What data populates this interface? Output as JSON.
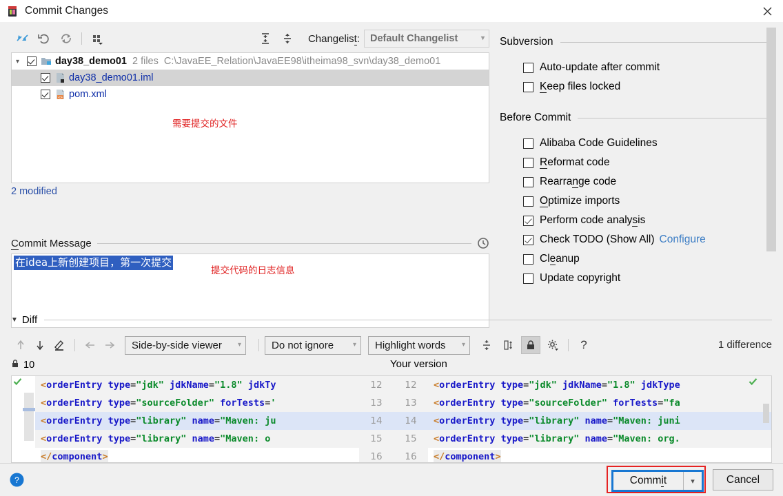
{
  "window": {
    "title": "Commit Changes",
    "app_icon": "intellij-idea-icon",
    "close_label": "✕"
  },
  "toolbar": {
    "buttons": [
      {
        "name": "show-diff-icon",
        "tooltip": "Show Diff"
      },
      {
        "name": "revert-icon",
        "tooltip": "Revert"
      },
      {
        "name": "refresh-icon",
        "tooltip": "Refresh"
      },
      {
        "name": "group-by-icon",
        "tooltip": "Group By"
      },
      {
        "name": "expand-all-icon",
        "tooltip": "Expand All"
      },
      {
        "name": "collapse-all-icon",
        "tooltip": "Collapse All"
      }
    ],
    "changelist_label": "Changelist:",
    "changelist_label_mnemonic": "Changelis",
    "changelist_label_underlined": "t",
    "changelist_label_tail": ":",
    "changelist_value": "Default Changelist"
  },
  "file_tree": {
    "root": {
      "name": "day38_demo01",
      "files_count": "2 files",
      "path": "C:\\JavaEE_Relation\\JavaEE98\\itheima98_svn\\day38_demo01",
      "checked": true,
      "expanded": true
    },
    "children": [
      {
        "name": "day38_demo01.iml",
        "checked": true,
        "selected": true,
        "icon": "iml-file-icon"
      },
      {
        "name": "pom.xml",
        "checked": true,
        "selected": false,
        "icon": "xml-file-icon"
      }
    ],
    "annotation": "需要提交的文件",
    "status": "2 modified"
  },
  "commit_message": {
    "label": "Commit Message",
    "label_mnemonic": "C",
    "label_rest": "ommit Message",
    "value": "在idea上新创建项目，第一次提交",
    "history_icon": "clock-icon",
    "annotation": "提交代码的日志信息"
  },
  "right_panel": {
    "groups": [
      {
        "title": "Subversion",
        "options": [
          {
            "label": "Auto-update after commit",
            "checked": false,
            "mnemonic": ""
          },
          {
            "label": "Keep files locked",
            "checked": false,
            "mnemonic": "K",
            "label_rest": "eep files locked"
          }
        ]
      },
      {
        "title": "Before Commit",
        "options": [
          {
            "label": "Alibaba Code Guidelines",
            "checked": false,
            "mnemonic": ""
          },
          {
            "label": "Reformat code",
            "checked": false,
            "mnemonic": "R",
            "label_rest": "eformat code"
          },
          {
            "label": "Rearrange code",
            "checked": false,
            "mnemonic": "",
            "pre": "Rearra",
            "mid": "n",
            "post": "ge code"
          },
          {
            "label": "Optimize imports",
            "checked": false,
            "mnemonic": "O",
            "label_rest": "ptimize imports"
          },
          {
            "label": "Perform code analysis",
            "checked": true,
            "pre": "Perform code analy",
            "mid": "s",
            "post": "is"
          },
          {
            "label": "Check TODO (Show All)",
            "checked": true,
            "link": "Configure"
          },
          {
            "label": "Cleanup",
            "checked": false,
            "pre": "Cl",
            "mid": "e",
            "post": "anup"
          },
          {
            "label": "Update copyright",
            "checked": false
          }
        ]
      }
    ]
  },
  "diff": {
    "section_label": "Diff",
    "expanded": true,
    "nav_buttons": [
      {
        "name": "previous-difference-icon"
      },
      {
        "name": "next-difference-icon"
      },
      {
        "name": "edit-source-icon"
      },
      {
        "name": "apply-left-icon"
      },
      {
        "name": "apply-right-icon"
      }
    ],
    "viewer_mode": "Side-by-side viewer",
    "ignore_mode": "Do not ignore",
    "highlight_mode": "Highlight words",
    "right_buttons": [
      {
        "name": "collapse-unchanged-icon",
        "pressed": false
      },
      {
        "name": "synchronize-scrolling-icon",
        "pressed": false
      },
      {
        "name": "read-only-lock-icon",
        "pressed": true
      },
      {
        "name": "settings-gear-icon",
        "pressed": false
      },
      {
        "name": "help-question-icon",
        "pressed": false
      }
    ],
    "difference_count": "1 difference",
    "left_lock_icon": "lock-icon",
    "left_line_count": "10",
    "right_title": "Your version",
    "left_lines": [
      {
        "num": "12",
        "text": "<orderEntry type=\"jdk\" jdkName=\"1.8\" jdkTy",
        "highlight": false
      },
      {
        "num": "13",
        "text": "<orderEntry type=\"sourceFolder\" forTests='",
        "highlight": false
      },
      {
        "num": "14",
        "text": "<orderEntry type=\"library\" name=\"Maven: ju",
        "highlight": true
      },
      {
        "num": "15",
        "text": "<orderEntry type=\"library\" name=\"Maven: o",
        "highlight": false
      },
      {
        "num": "16",
        "text": "</component>",
        "highlight": false
      }
    ],
    "right_lines": [
      {
        "num": "12",
        "text": "<orderEntry type=\"jdk\" jdkName=\"1.8\" jdkType",
        "highlight": false
      },
      {
        "num": "13",
        "text": "<orderEntry type=\"sourceFolder\" forTests=\"fa",
        "highlight": false
      },
      {
        "num": "14",
        "text": "<orderEntry type=\"library\" name=\"Maven: juni",
        "highlight": true
      },
      {
        "num": "15",
        "text": "<orderEntry type=\"library\" name=\"Maven: org.",
        "highlight": false
      },
      {
        "num": "16",
        "text": "</component>",
        "highlight": false
      }
    ]
  },
  "footer": {
    "help_icon": "help-icon",
    "commit_label": "Commit",
    "commit_mnemonic_pre": "Comm",
    "commit_mnemonic": "i",
    "commit_mnemonic_post": "t",
    "commit_dropdown_icon": "chevron-down-icon",
    "cancel_label": "Cancel"
  },
  "colors": {
    "accent_blue": "#1877d2",
    "annotation_red": "#e02020",
    "link_blue": "#3a7cc4",
    "selection_blue": "#2f5fc0",
    "highlight_row": "#dce5f7"
  }
}
